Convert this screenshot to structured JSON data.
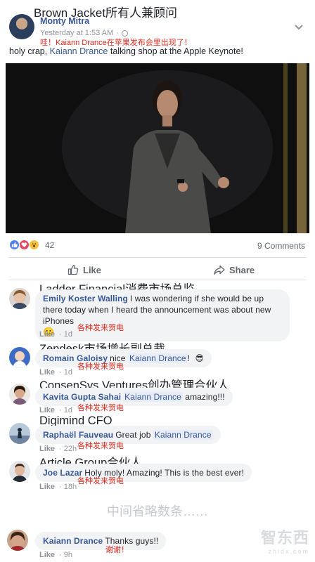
{
  "post": {
    "overlay_title": "Brown Jacket所有人兼顾问",
    "author": "Monty Mitra",
    "timestamp": "Yesterday at 1:53 AM",
    "dot": "·",
    "overlay_caption": "哇！Kaiann Drance在苹果发布会里出现了！",
    "text_before": "holy crap, ",
    "mention": "Kaiann Drance",
    "text_after": " talking shop at the Apple Keynote!",
    "reaction_count": "42",
    "comments_count": "9 Comments",
    "like_label": "Like",
    "share_label": "Share"
  },
  "comments": [
    {
      "overlay_title": "Ladder Financial消费市场总监",
      "author": "Emily Koster Walling",
      "text": "I was wondering if she would be up there today when I heard the announcement was about new iPhones",
      "emoji": "🙂",
      "like": "Like",
      "time": "1d",
      "overlay_caption": "各种发来贺电"
    },
    {
      "overlay_title": "Zendesk市场增长副总裁",
      "author": "Romain Galoisy",
      "text_before": "nice ",
      "mention": "Kaiann Drance",
      "text_after": "!",
      "emoji": "😎",
      "like": "Like",
      "time": "1d",
      "overlay_caption": "各种发来贺电"
    },
    {
      "overlay_title": "ConsenSys Ventures创办管理合伙人",
      "author": "Kavita Gupta Sahai",
      "mention": "Kaiann Drance",
      "text_after": " amazing!!!",
      "like": "Like",
      "time": "1d",
      "overlay_caption": "各种发来贺电"
    },
    {
      "overlay_title": "Digimind CFO",
      "author": "Raphaël Fauveau",
      "text_before": "Great job ",
      "mention": "Kaiann Drance",
      "like": "Like",
      "time": "22h",
      "overlay_caption": "各种发来贺电"
    },
    {
      "overlay_title": "Article Group合伙人",
      "author": "Joe Lazar",
      "text": "Holy moly! Amazing! This is the best ever!",
      "like": "Like",
      "time": "18h",
      "overlay_caption": "各种发来贺电"
    },
    {
      "author": "Kaiann Drance",
      "text": "Thanks guys!!",
      "like": "Like",
      "time": "9h",
      "overlay_caption": "谢谢！"
    }
  ],
  "omitted_note": "中间省略数条……",
  "watermark": {
    "logo": "智东西",
    "url": "zhidx.com"
  },
  "colors": {
    "link_blue": "#365899",
    "overlay_red": "#e0281c",
    "bubble": "#f2f3f5"
  }
}
